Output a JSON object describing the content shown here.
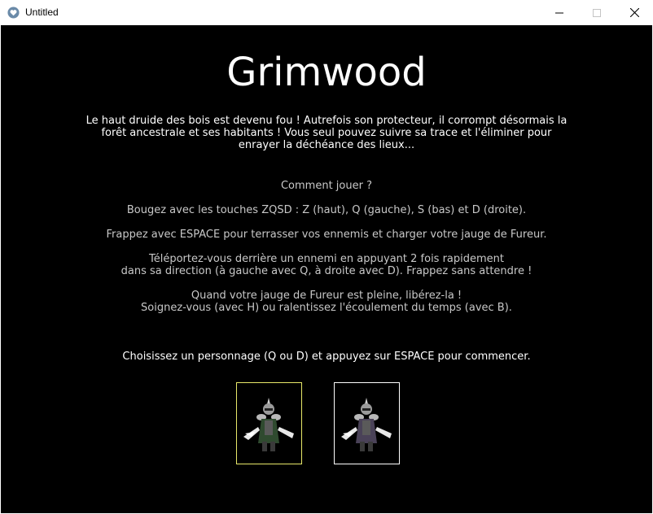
{
  "window": {
    "title": "Untitled",
    "icon": "heart-app-icon",
    "controls": [
      "minimize-icon",
      "maximize-icon",
      "close-icon"
    ]
  },
  "game": {
    "title": "Grimwood",
    "intro": "Le haut druide des bois est devenu fou ! Autrefois son protecteur, il corrompt désormais la forêt ancestrale et ses habitants ! Vous seul pouvez suivre sa trace et l'éliminer pour enrayer la déchéance des lieux...",
    "howto_title": "Comment jouer ?",
    "howto_move": "Bougez avec les touches ZQSD : Z (haut), Q (gauche), S (bas) et D (droite).",
    "howto_attack": "Frappez avec ESPACE pour terrasser vos ennemis et charger votre jauge de Fureur.",
    "howto_teleport": "Téléportez-vous derrière un ennemi en appuyant 2 fois rapidement\ndans sa direction (à gauche avec Q, à droite avec D). Frappez sans attendre !",
    "howto_fury": "Quand votre jauge de Fureur est pleine, libérez-la !\nSoignez-vous (avec H) ou ralentissez l'écoulement du temps (avec B).",
    "choose_prompt": "Choisissez un personnage (Q ou D) et appuyez sur ESPACE pour commencer.",
    "characters": [
      {
        "icon": "green-warrior-sprite",
        "selected": true,
        "color": "#2f4a2f"
      },
      {
        "icon": "purple-warrior-sprite",
        "selected": false,
        "color": "#4a4258"
      }
    ]
  },
  "colors": {
    "background": "#000000",
    "text": "#ffffff",
    "muted_text": "#c8c8c8",
    "selected_border": "#e8e86a",
    "unselected_border": "#ffffff"
  }
}
